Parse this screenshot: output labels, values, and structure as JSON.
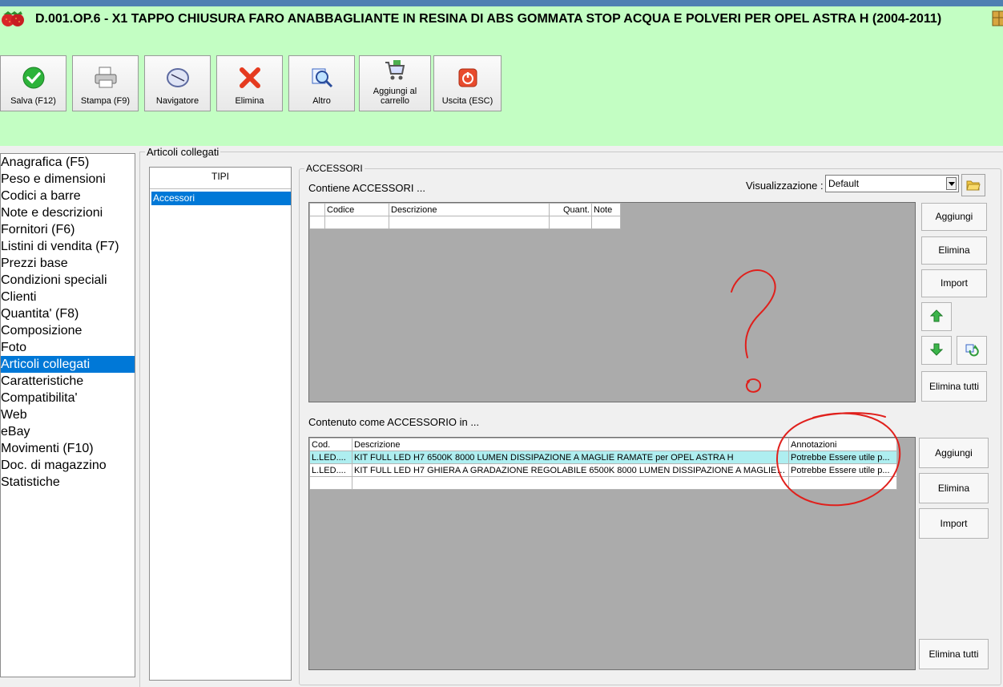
{
  "window": {
    "product_title": "D.001.OP.6 - X1 TAPPO CHIUSURA FARO ANABBAGLIANTE IN RESINA DI ABS GOMMATA STOP ACQUA E POLVERI PER OPEL ASTRA H (2004-2011)"
  },
  "toolbar": {
    "buttons": [
      {
        "label": "Salva (F12)",
        "icon": "check-icon"
      },
      {
        "label": "Stampa (F9)",
        "icon": "printer-icon"
      },
      {
        "label": "Navigatore",
        "icon": "compass-icon"
      },
      {
        "label": "Elimina",
        "icon": "x-icon"
      },
      {
        "label": "Altro",
        "icon": "magnifier-icon"
      },
      {
        "label": "Aggiungi al carrello",
        "icon": "cart-icon"
      },
      {
        "label": "Uscita (ESC)",
        "icon": "power-icon"
      }
    ]
  },
  "nav": {
    "items": [
      "Anagrafica (F5)",
      "Peso e dimensioni",
      "Codici a barre",
      "Note e descrizioni",
      "Fornitori (F6)",
      "Listini di vendita (F7)",
      "Prezzi base",
      "Condizioni speciali",
      "Clienti",
      "Quantita' (F8)",
      "Composizione",
      "Foto",
      "Articoli collegati",
      "Caratteristiche",
      "Compatibilita'",
      "Web",
      "eBay",
      "Movimenti (F10)",
      "Doc. di magazzino",
      "Statistiche"
    ],
    "selected": "Articoli collegati"
  },
  "collegati": {
    "legend": "Articoli collegati",
    "tipi_header": "TIPI",
    "tipi_items": [
      "Accessori"
    ]
  },
  "accessori": {
    "legend": "ACCESSORI",
    "contiene_label": "Contiene ACCESSORI ...",
    "visualizzazione_label": "Visualizzazione :",
    "visualizzazione_value": "Default",
    "top_grid": {
      "columns": [
        "Codice",
        "Descrizione",
        "Quant.",
        "Note"
      ]
    },
    "top_buttons": {
      "aggiungi": "Aggiungi",
      "elimina": "Elimina",
      "import": "Import",
      "elimina_tutti": "Elimina tutti"
    },
    "contenuto_label": "Contenuto come ACCESSORIO in ...",
    "bottom_grid": {
      "columns": [
        "Cod.",
        "Descrizione",
        "Annotazioni"
      ],
      "rows": [
        {
          "cod": "L.LED....",
          "descrizione": "KIT FULL LED H7 6500K 8000 LUMEN DISSIPAZIONE A MAGLIE RAMATE per OPEL ASTRA H",
          "annotazioni": "Potrebbe Essere utile p..."
        },
        {
          "cod": "L.LED....",
          "descrizione": "KIT FULL LED H7 GHIERA A GRADAZIONE REGOLABILE 6500K 8000 LUMEN DISSIPAZIONE A MAGLIE RAMATE ...",
          "annotazioni": "Potrebbe Essere utile p..."
        }
      ]
    },
    "bottom_buttons": {
      "aggiungi": "Aggiungi",
      "elimina": "Elimina",
      "import": "Import",
      "elimina_tutti": "Elimina tutti"
    }
  },
  "colors": {
    "header_bg": "#c3fec3",
    "selection": "#0078d7",
    "row_highlight": "#aeeef0",
    "annotation_ink": "#e0201c"
  }
}
